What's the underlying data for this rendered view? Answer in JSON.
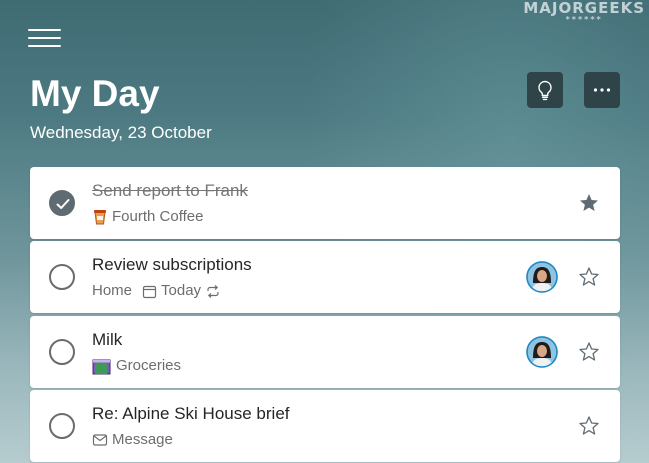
{
  "watermark": {
    "brand": "MAJORGEEKS",
    "stars": "******"
  },
  "header": {
    "title": "My Day",
    "date": "Wednesday, 23 October",
    "menu_icon": "hamburger-menu-icon",
    "suggestions_icon": "lightbulb-icon",
    "more_icon": "more-options-icon"
  },
  "tasks": [
    {
      "title": "Send report to Frank",
      "completed": true,
      "important": true,
      "list_icon": "coffee-cup-icon",
      "list": "Fourth Coffee"
    },
    {
      "title": "Review subscriptions",
      "completed": false,
      "important": false,
      "list": "Home",
      "due_icon": "calendar-icon",
      "due": "Today",
      "repeat_icon": "repeat-icon",
      "assigned": true
    },
    {
      "title": "Milk",
      "completed": false,
      "important": false,
      "list_icon": "groceries-icon",
      "list": "Groceries",
      "assigned": true
    },
    {
      "title": "Re: Alpine Ski House brief",
      "completed": false,
      "important": false,
      "list_icon": "mail-icon",
      "list": "Message"
    }
  ],
  "colors": {
    "background_top": "#3f6b73",
    "background_bottom": "#b6cccf",
    "header_button": "#2f4448",
    "completed_check": "#5f6b73",
    "star_filled": "#5f6b73"
  }
}
